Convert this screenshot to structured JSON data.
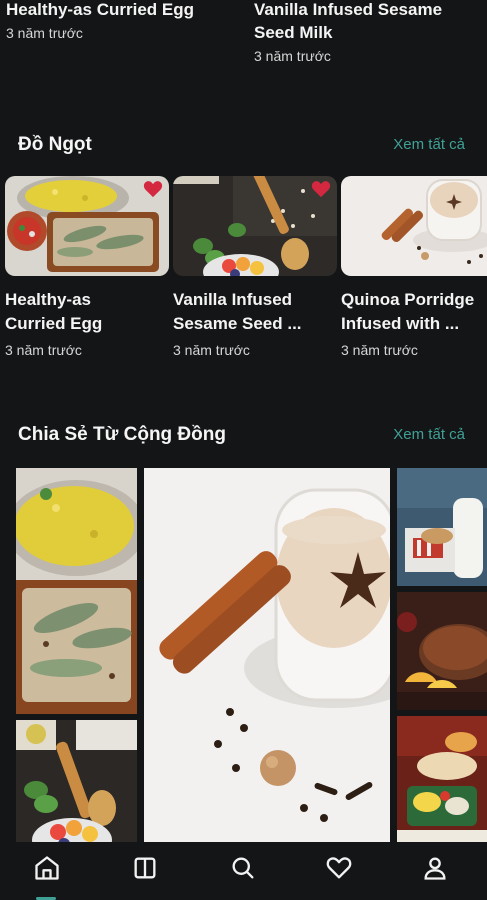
{
  "top_cards": [
    {
      "title": "Healthy-as Curried Egg",
      "time": "3 năm trước"
    },
    {
      "title": "Vanilla Infused Sesame Seed Milk",
      "time": "3 năm trước"
    }
  ],
  "sections": {
    "dessert": {
      "title": "Đồ Ngọt",
      "see_all": "Xem tất cả"
    },
    "community": {
      "title": "Chia Sẻ Từ Cộng Đồng",
      "see_all": "Xem tất cả"
    }
  },
  "dessert_cards": [
    {
      "title_line1": "Healthy-as",
      "title_line2": "Curried Egg",
      "time": "3 năm trước",
      "favorited": true
    },
    {
      "title_line1": "Vanilla Infused",
      "title_line2": "Sesame Seed ...",
      "time": "3 năm trước",
      "favorited": true
    },
    {
      "title_line1": "Quinoa Porridge",
      "title_line2": "Infused with ...",
      "time": "3 năm trước",
      "favorited": false
    }
  ],
  "bottom_nav": [
    {
      "name": "home-icon",
      "active": true
    },
    {
      "name": "book-icon",
      "active": false
    },
    {
      "name": "search-icon",
      "active": false
    },
    {
      "name": "heart-icon",
      "active": false
    },
    {
      "name": "profile-icon",
      "active": false
    }
  ],
  "colors": {
    "accent": "#3fa196",
    "background": "#141516",
    "heart": "#d3283f"
  }
}
